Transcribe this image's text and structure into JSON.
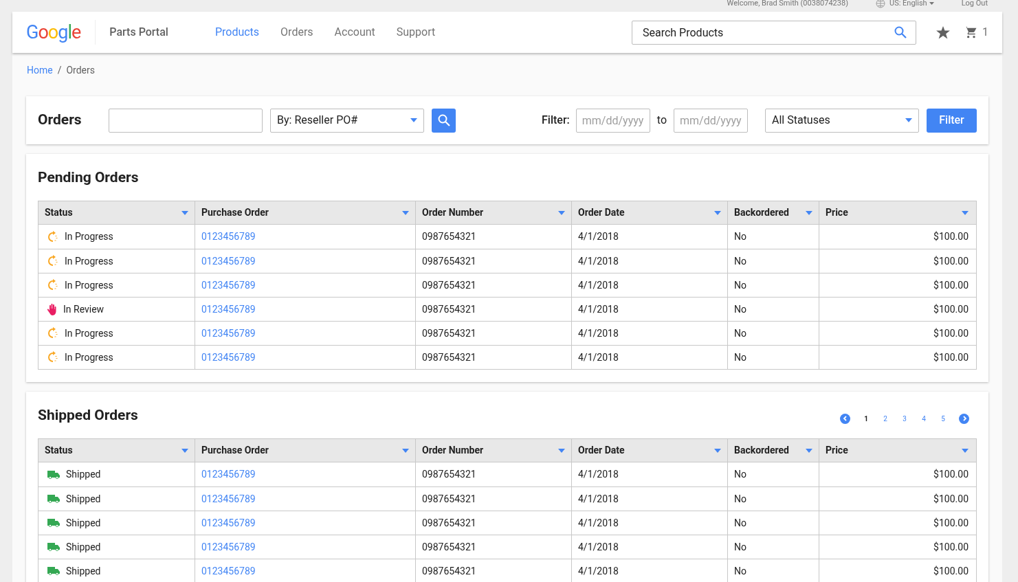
{
  "top_bar": {
    "welcome": "Welcome, Brad Smith (0038074238)",
    "language": "US: English",
    "logout": "Log Out"
  },
  "header": {
    "logo": "Google",
    "app_name": "Parts Portal",
    "nav": [
      {
        "label": "Products",
        "selected": true
      },
      {
        "label": "Orders",
        "selected": false
      },
      {
        "label": "Account",
        "selected": false
      },
      {
        "label": "Support",
        "selected": false
      }
    ],
    "search": {
      "placeholder": "Search Products"
    },
    "cart_count": "1"
  },
  "breadcrumb": [
    {
      "label": "Home",
      "kind": "link"
    },
    {
      "label": "/",
      "kind": "separator"
    },
    {
      "label": "Orders",
      "kind": "current"
    }
  ],
  "orders_bar": {
    "title": "Orders",
    "search_by": "By: Reseller PO#",
    "filter_label": "Filter:",
    "from": {
      "placeholder": "mm/dd/yyyy"
    },
    "to_label": "to",
    "to": {
      "placeholder": "mm/dd/yyyy"
    },
    "status": "All Statuses",
    "filter_button": "Filter"
  },
  "sections": [
    {
      "title": "Pending Orders",
      "columns": [
        "Status",
        "Purchase Order",
        "Order Number",
        "Order Date",
        "Backordered",
        "Price"
      ],
      "rows": [
        {
          "kind": "progress",
          "status": "In Progress",
          "po": "0123456789",
          "order": "0987654321",
          "date": "4/1/2018",
          "backordered": "No",
          "price": "$100.00"
        },
        {
          "kind": "progress",
          "status": "In Progress",
          "po": "0123456789",
          "order": "0987654321",
          "date": "4/1/2018",
          "backordered": "No",
          "price": "$100.00"
        },
        {
          "kind": "progress",
          "status": "In Progress",
          "po": "0123456789",
          "order": "0987654321",
          "date": "4/1/2018",
          "backordered": "No",
          "price": "$100.00"
        },
        {
          "kind": "review",
          "status": "In Review",
          "po": "0123456789",
          "order": "0987654321",
          "date": "4/1/2018",
          "backordered": "No",
          "price": "$100.00"
        },
        {
          "kind": "progress",
          "status": "In Progress",
          "po": "0123456789",
          "order": "0987654321",
          "date": "4/1/2018",
          "backordered": "No",
          "price": "$100.00"
        },
        {
          "kind": "progress",
          "status": "In Progress",
          "po": "0123456789",
          "order": "0987654321",
          "date": "4/1/2018",
          "backordered": "No",
          "price": "$100.00"
        }
      ]
    },
    {
      "title": "Shipped Orders",
      "pagination": [
        {
          "label": "1",
          "selected": true
        },
        {
          "label": "2",
          "selected": false
        },
        {
          "label": "3",
          "selected": false
        },
        {
          "label": "4",
          "selected": false
        },
        {
          "label": "5",
          "selected": false
        }
      ],
      "columns": [
        "Status",
        "Purchase Order",
        "Order Number",
        "Order Date",
        "Backordered",
        "Price"
      ],
      "rows": [
        {
          "kind": "shipped",
          "status": "Shipped",
          "po": "0123456789",
          "order": "0987654321",
          "date": "4/1/2018",
          "backordered": "No",
          "price": "$100.00"
        },
        {
          "kind": "shipped",
          "status": "Shipped",
          "po": "0123456789",
          "order": "0987654321",
          "date": "4/1/2018",
          "backordered": "No",
          "price": "$100.00"
        },
        {
          "kind": "shipped",
          "status": "Shipped",
          "po": "0123456789",
          "order": "0987654321",
          "date": "4/1/2018",
          "backordered": "No",
          "price": "$100.00"
        },
        {
          "kind": "shipped",
          "status": "Shipped",
          "po": "0123456789",
          "order": "0987654321",
          "date": "4/1/2018",
          "backordered": "No",
          "price": "$100.00"
        },
        {
          "kind": "shipped",
          "status": "Shipped",
          "po": "0123456789",
          "order": "0987654321",
          "date": "4/1/2018",
          "backordered": "No",
          "price": "$100.00"
        }
      ]
    }
  ]
}
